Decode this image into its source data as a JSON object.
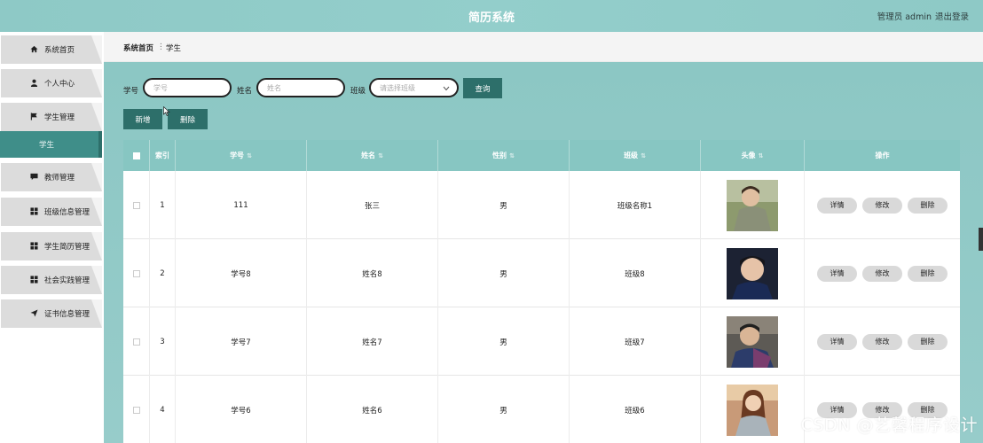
{
  "header": {
    "title": "简历系统",
    "admin": "管理员 admin",
    "logout": "退出登录"
  },
  "sidebar": {
    "items": [
      {
        "label": "系统首页",
        "icon": "home-icon"
      },
      {
        "label": "个人中心",
        "icon": "user-icon"
      },
      {
        "label": "学生管理",
        "icon": "flag-icon"
      },
      {
        "label": "教师管理",
        "icon": "message-icon"
      },
      {
        "label": "班级信息管理",
        "icon": "grid-icon"
      },
      {
        "label": "学生简历管理",
        "icon": "grid-icon"
      },
      {
        "label": "社会实践管理",
        "icon": "grid-icon"
      },
      {
        "label": "证书信息管理",
        "icon": "send-icon"
      }
    ],
    "active_sub": "学生"
  },
  "breadcrumb": {
    "home": "系统首页",
    "sep": "⋮",
    "current": "学生"
  },
  "search": {
    "xuehao_label": "学号",
    "xuehao_placeholder": "学号",
    "xingming_label": "姓名",
    "xingming_placeholder": "姓名",
    "banji_label": "班级",
    "banji_placeholder": "请选择班级",
    "query_button": "查询"
  },
  "actions": {
    "add": "新增",
    "delete": "删除"
  },
  "table": {
    "headers": [
      "索引",
      "学号",
      "姓名",
      "性别",
      "班级",
      "头像",
      "操作"
    ],
    "rows": [
      {
        "index": "1",
        "xuehao": "111",
        "xingming": "张三",
        "xingbie": "男",
        "banji": "班级名称1"
      },
      {
        "index": "2",
        "xuehao": "学号8",
        "xingming": "姓名8",
        "xingbie": "男",
        "banji": "班级8"
      },
      {
        "index": "3",
        "xuehao": "学号7",
        "xingming": "姓名7",
        "xingbie": "男",
        "banji": "班级7"
      },
      {
        "index": "4",
        "xuehao": "学号6",
        "xingming": "姓名6",
        "xingbie": "男",
        "banji": "班级6"
      }
    ],
    "op_detail": "详情",
    "op_edit": "修改",
    "op_delete": "删除"
  },
  "watermark": "CSDN @艺馨程序设计",
  "colors": {
    "accent": "#2d6f6a",
    "header_bg": "#8ec9c6",
    "table_head": "#87c6c2"
  }
}
